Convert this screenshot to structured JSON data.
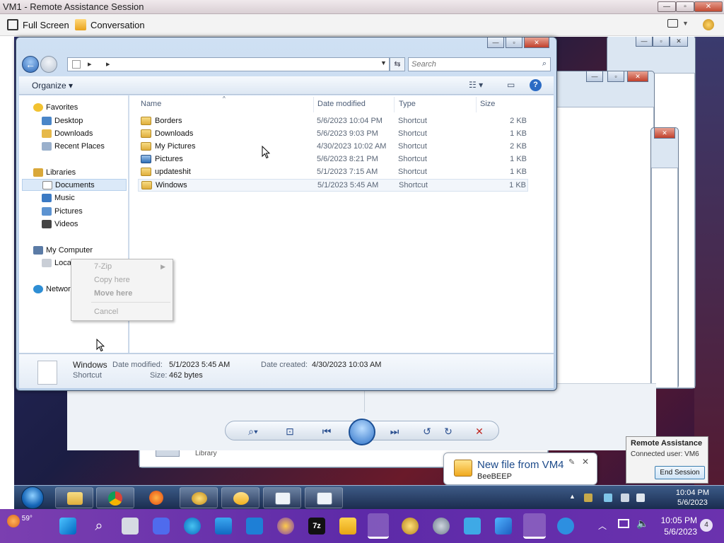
{
  "ra_window": {
    "title": "VM1 - Remote Assistance Session",
    "minimize": "—",
    "maximize": "▫",
    "close": "✕"
  },
  "ra_toolbar": {
    "full_screen": "Full Screen",
    "conversation": "Conversation"
  },
  "explorer": {
    "address_separator_1": "▸",
    "address_separator_2": "▸",
    "search_placeholder": "Search",
    "organize_label": "Organize ▾",
    "nav": {
      "favorites": "Favorites",
      "desktop": "Desktop",
      "downloads": "Downloads",
      "recent_places": "Recent Places",
      "libraries": "Libraries",
      "documents": "Documents",
      "music": "Music",
      "pictures": "Pictures",
      "videos": "Videos",
      "my_computer": "My Computer",
      "local_disk": "Local Disk (C:)",
      "network": "Network"
    },
    "columns": {
      "name": "Name",
      "date_modified": "Date modified",
      "type": "Type",
      "size": "Size"
    },
    "files": [
      {
        "name": "Borders",
        "date": "5/6/2023 10:04 PM",
        "type": "Shortcut",
        "size": "2 KB",
        "icon": "folder-icon"
      },
      {
        "name": "Downloads",
        "date": "5/6/2023 9:03 PM",
        "type": "Shortcut",
        "size": "1 KB",
        "icon": "folder-icon"
      },
      {
        "name": "My Pictures",
        "date": "4/30/2023 10:02 AM",
        "type": "Shortcut",
        "size": "2 KB",
        "icon": "folder-icon"
      },
      {
        "name": "Pictures",
        "date": "5/6/2023 8:21 PM",
        "type": "Shortcut",
        "size": "1 KB",
        "icon": "pictures-icon"
      },
      {
        "name": "updateshit",
        "date": "5/1/2023 7:15 AM",
        "type": "Shortcut",
        "size": "1 KB",
        "icon": "folder-icon"
      },
      {
        "name": "Windows",
        "date": "5/1/2023 5:45 AM",
        "type": "Shortcut",
        "size": "1 KB",
        "icon": "folder-icon"
      }
    ],
    "details": {
      "name": "Windows",
      "kind": "Shortcut",
      "date_modified_label": "Date modified:",
      "date_modified": "5/1/2023 5:45 AM",
      "date_created_label": "Date created:",
      "date_created": "4/30/2023 10:03 AM",
      "size_label": "Size:",
      "size": "462 bytes"
    }
  },
  "context_menu": {
    "items": [
      "7-Zip",
      "Copy here",
      "Move here",
      "Cancel"
    ]
  },
  "background_window": {
    "library_label": "Library"
  },
  "beebeep_popup": {
    "title": "New file from VM4",
    "app": "BeeBEEP"
  },
  "ra_status": {
    "title": "Remote Assistance",
    "connected": "Connected user: VM6",
    "end_session": "End Session"
  },
  "remote_taskbar": {
    "time": "10:04 PM",
    "date": "5/6/2023"
  },
  "host_taskbar": {
    "temperature": "59°",
    "time": "10:05 PM",
    "date": "5/6/2023",
    "notifications": "4"
  },
  "colors": {
    "selection": "#dbe9f8",
    "host_taskbar": "#6b32ae",
    "help_blue": "#2b6bc4"
  }
}
